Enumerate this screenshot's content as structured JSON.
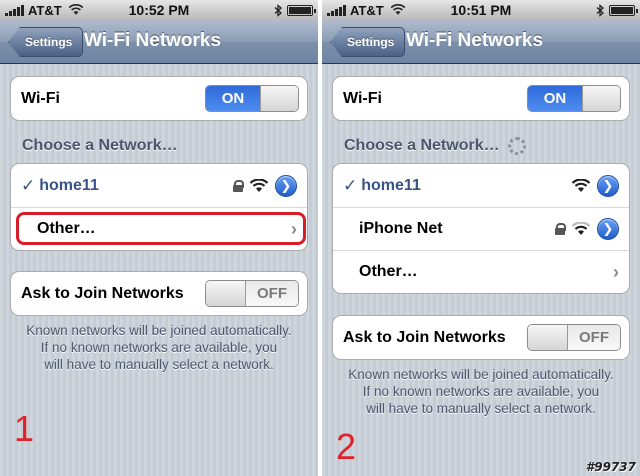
{
  "screens": [
    {
      "status": {
        "carrier": "AT&T",
        "time": "10:52 PM"
      },
      "nav": {
        "back_label": "Settings",
        "title": "Wi-Fi Networks"
      },
      "wifi_row": {
        "label": "Wi-Fi",
        "toggle_label": "ON"
      },
      "section_header": "Choose a Network…",
      "networks": [
        {
          "check": "✓",
          "name": "home11",
          "locked": true
        },
        {
          "name": "Other…"
        }
      ],
      "ask_row": {
        "label": "Ask to Join Networks",
        "toggle_label": "OFF"
      },
      "footer_lines": [
        "Known networks will be joined automatically.",
        "If no known networks are available, you",
        "will have to manually select a network."
      ],
      "step": "1"
    },
    {
      "status": {
        "carrier": "AT&T",
        "time": "10:51 PM"
      },
      "nav": {
        "back_label": "Settings",
        "title": "Wi-Fi Networks"
      },
      "wifi_row": {
        "label": "Wi-Fi",
        "toggle_label": "ON"
      },
      "section_header": "Choose a Network…",
      "networks": [
        {
          "check": "✓",
          "name": "home11",
          "locked": false
        },
        {
          "name": "iPhone Net",
          "locked": true
        },
        {
          "name": "Other…"
        }
      ],
      "ask_row": {
        "label": "Ask to Join Networks",
        "toggle_label": "OFF"
      },
      "footer_lines": [
        "Known networks will be joined automatically.",
        "If no known networks are available, you",
        "will have to manually select a network."
      ],
      "step": "2"
    }
  ],
  "watermark": "#99737",
  "colors": {
    "accent_blue": "#385487",
    "highlight_red": "#d71e28",
    "step_red": "#e0232b"
  },
  "icons": [
    "wifi-icon",
    "lock-icon",
    "detail-disclosure-icon",
    "chevron-right-icon",
    "bluetooth-icon",
    "battery-icon",
    "signal-icon"
  ]
}
